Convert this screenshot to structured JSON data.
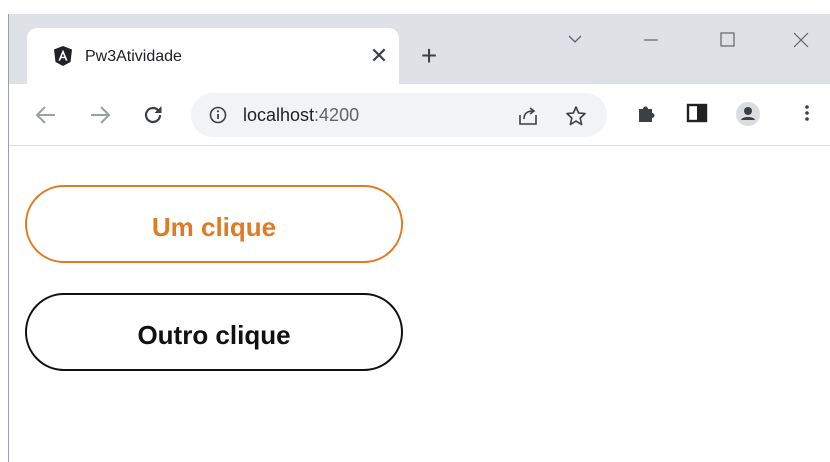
{
  "browser": {
    "tab": {
      "title": "Pw3Atividade",
      "favicon": "angular-logo-icon",
      "close_glyph": "✕"
    },
    "new_tab_glyph": "+",
    "address": {
      "host": "localhost",
      "port": ":4200"
    }
  },
  "page": {
    "buttons": [
      {
        "label": "Um clique",
        "color": "#e07b24"
      },
      {
        "label": "Outro clique",
        "color": "#111111"
      }
    ]
  }
}
